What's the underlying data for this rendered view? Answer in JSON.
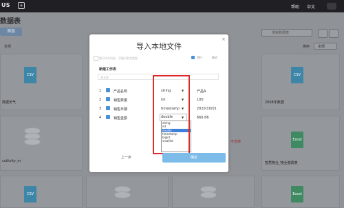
{
  "topbar": {
    "brand": "US",
    "add_label": "+",
    "help": "帮助",
    "language": "中文"
  },
  "background": {
    "page_title": "数据表",
    "add_button": "添加",
    "search_placeholder": "搜索数据表",
    "filter_all": "全部",
    "sort_label": "排序",
    "sort_value": "全部",
    "cards": [
      {
        "label": "数据天气",
        "kind": "CSV"
      },
      {
        "label": "2008年数据",
        "kind": "CSV"
      },
      {
        "label": "cuitivity_m",
        "kind": "DB"
      },
      {
        "label": "智慧物业_物业缴费表",
        "kind": "Excel"
      },
      {
        "label": "",
        "kind": "CSV"
      },
      {
        "label": "",
        "kind": "Excel"
      }
    ],
    "warning_text": "不支持"
  },
  "modal": {
    "title": "导入本地文件",
    "close": "×",
    "tip": "首行作为列名，不能识别列类型",
    "option_checked": "首行",
    "option2": "格式",
    "sheet_title": "新建工作表",
    "table_name_placeholder": "表名称",
    "rows": [
      {
        "index": "1",
        "name": "产品名称",
        "type": "string",
        "example": "产品A"
      },
      {
        "index": "2",
        "name": "销售数量",
        "type": "int",
        "example": "100"
      },
      {
        "index": "3",
        "name": "销售日期",
        "type": "timestamp",
        "example": "2020/10/01"
      },
      {
        "index": "4",
        "name": "销售金额",
        "type": "double",
        "example": "666.66"
      }
    ],
    "type_options": [
      "string",
      "int",
      "double",
      "timestamp",
      "bigint",
      "smallint"
    ],
    "selected_option": "double",
    "prev_button": "上一步",
    "confirm_button": "确定",
    "highlight_color": "#e02828",
    "accent_color": "#4a90d9"
  }
}
